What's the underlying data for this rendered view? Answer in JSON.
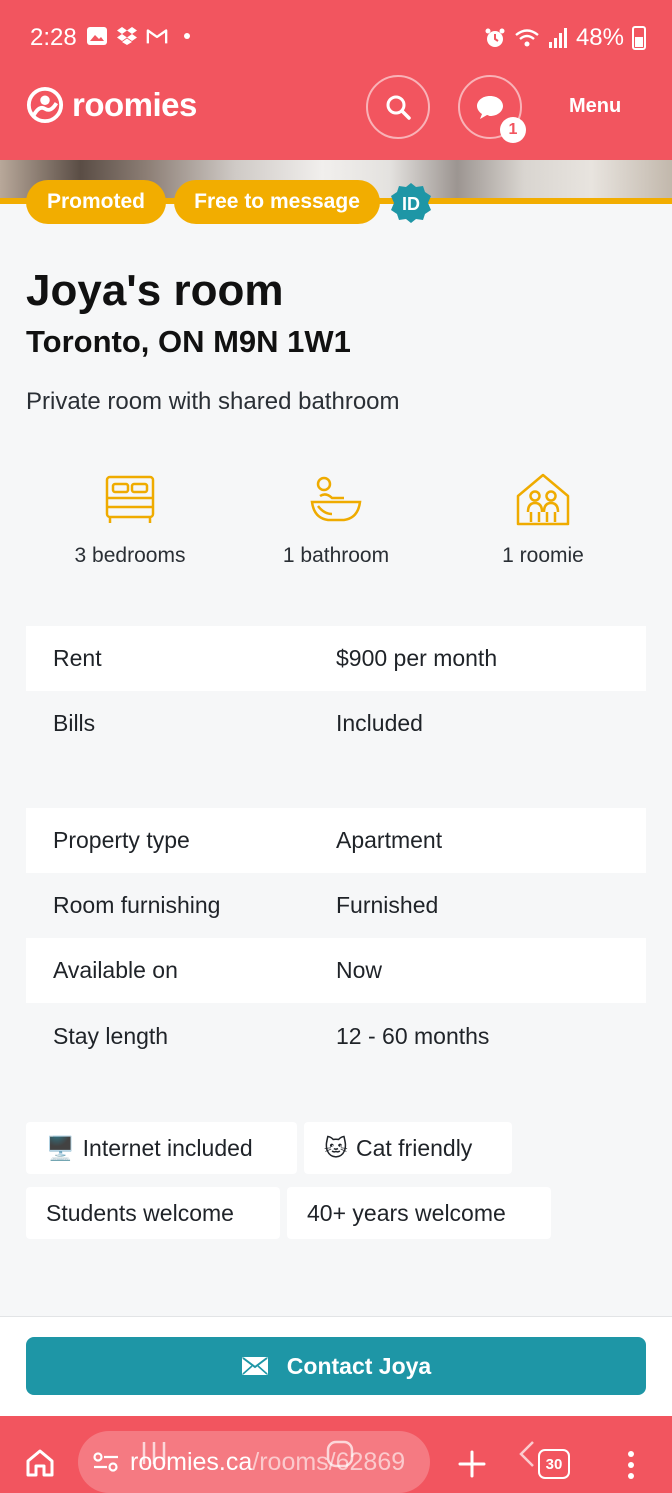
{
  "status_bar": {
    "time": "2:28",
    "battery": "48%",
    "icons": [
      "gallery-icon",
      "dropbox-icon",
      "gmail-icon",
      "alarm-icon",
      "wifi-icon",
      "signal-icon",
      "battery-icon"
    ]
  },
  "header": {
    "brand": "roomies",
    "menu_label": "Menu",
    "message_badge": "1",
    "accent_color": "#f2555f"
  },
  "badges": {
    "promoted": "Promoted",
    "free_to_message": "Free to message",
    "id": "ID"
  },
  "listing": {
    "title": "Joya's room",
    "location": "Toronto, ON M9N 1W1",
    "room_type": "Private room with shared bathroom"
  },
  "features": [
    {
      "icon": "bed-icon",
      "label": "3 bedrooms"
    },
    {
      "icon": "bath-icon",
      "label": "1 bathroom"
    },
    {
      "icon": "roomies-icon",
      "label": "1 roomie"
    }
  ],
  "details_group_1": [
    {
      "key": "Rent",
      "value": "$900 per month"
    },
    {
      "key": "Bills",
      "value": "Included"
    }
  ],
  "details_group_2": [
    {
      "key": "Property type",
      "value": "Apartment"
    },
    {
      "key": "Room furnishing",
      "value": "Furnished"
    },
    {
      "key": "Available on",
      "value": "Now"
    },
    {
      "key": "Stay length",
      "value": "12 - 60 months"
    }
  ],
  "tags": [
    {
      "emoji": "🖥️",
      "label": "Internet included"
    },
    {
      "emoji": "🐱",
      "label": "Cat friendly"
    },
    {
      "emoji": "",
      "label": "Students welcome"
    },
    {
      "emoji": "",
      "label": "40+ years welcome"
    }
  ],
  "cta": {
    "label": "Contact Joya",
    "color": "#1e96a6"
  },
  "browser_bar": {
    "url_host": "roomies.ca",
    "url_path": "/rooms/62869",
    "tab_count": "30"
  }
}
